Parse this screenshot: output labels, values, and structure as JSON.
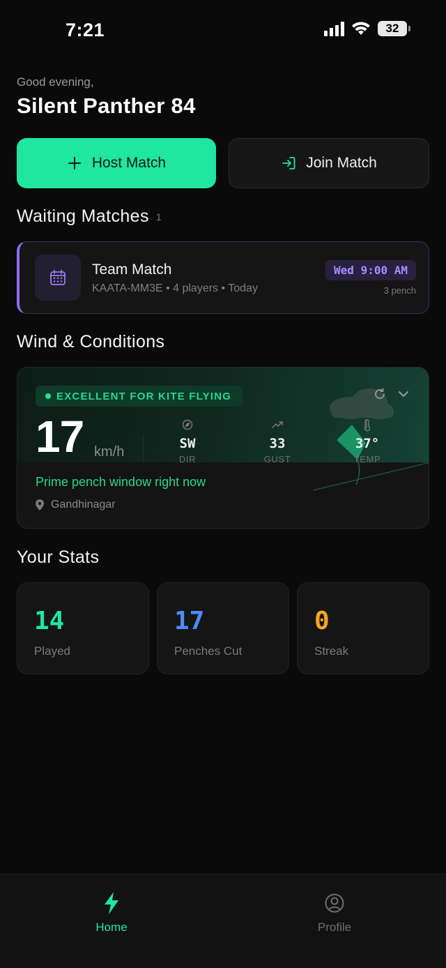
{
  "status_bar": {
    "time": "7:21",
    "battery": "32"
  },
  "header": {
    "greeting": "Good evening,",
    "username": "Silent Panther 84"
  },
  "actions": {
    "host_label": "Host Match",
    "join_label": "Join Match"
  },
  "waiting": {
    "title": "Waiting Matches",
    "count": "1",
    "match": {
      "title": "Team Match",
      "subtitle": "KAATA-MM3E • 4 players • Today",
      "time": "Wed 9:00 AM",
      "pench": "3 pench"
    }
  },
  "wind": {
    "title": "Wind & Conditions",
    "badge": "EXCELLENT FOR KITE FLYING",
    "speed": "17",
    "unit": "km/h",
    "dir": {
      "value": "SW",
      "label": "DIR"
    },
    "gust": {
      "value": "33",
      "label": "GUST"
    },
    "temp": {
      "value": "37°",
      "label": "TEMP"
    },
    "message": "Prime pench window right now",
    "location": "Gandhinagar"
  },
  "stats": {
    "title": "Your Stats",
    "items": [
      {
        "value": "14",
        "label": "Played",
        "color": "#1fe6a0"
      },
      {
        "value": "17",
        "label": "Penches Cut",
        "color": "#4d8dff"
      },
      {
        "value": "0",
        "label": "Streak",
        "color": "#f5a623"
      }
    ]
  },
  "tabs": {
    "home": "Home",
    "profile": "Profile"
  },
  "colors": {
    "accent": "#1fe6a0",
    "purple": "#8b6cf0",
    "background": "#0a0a0a"
  }
}
